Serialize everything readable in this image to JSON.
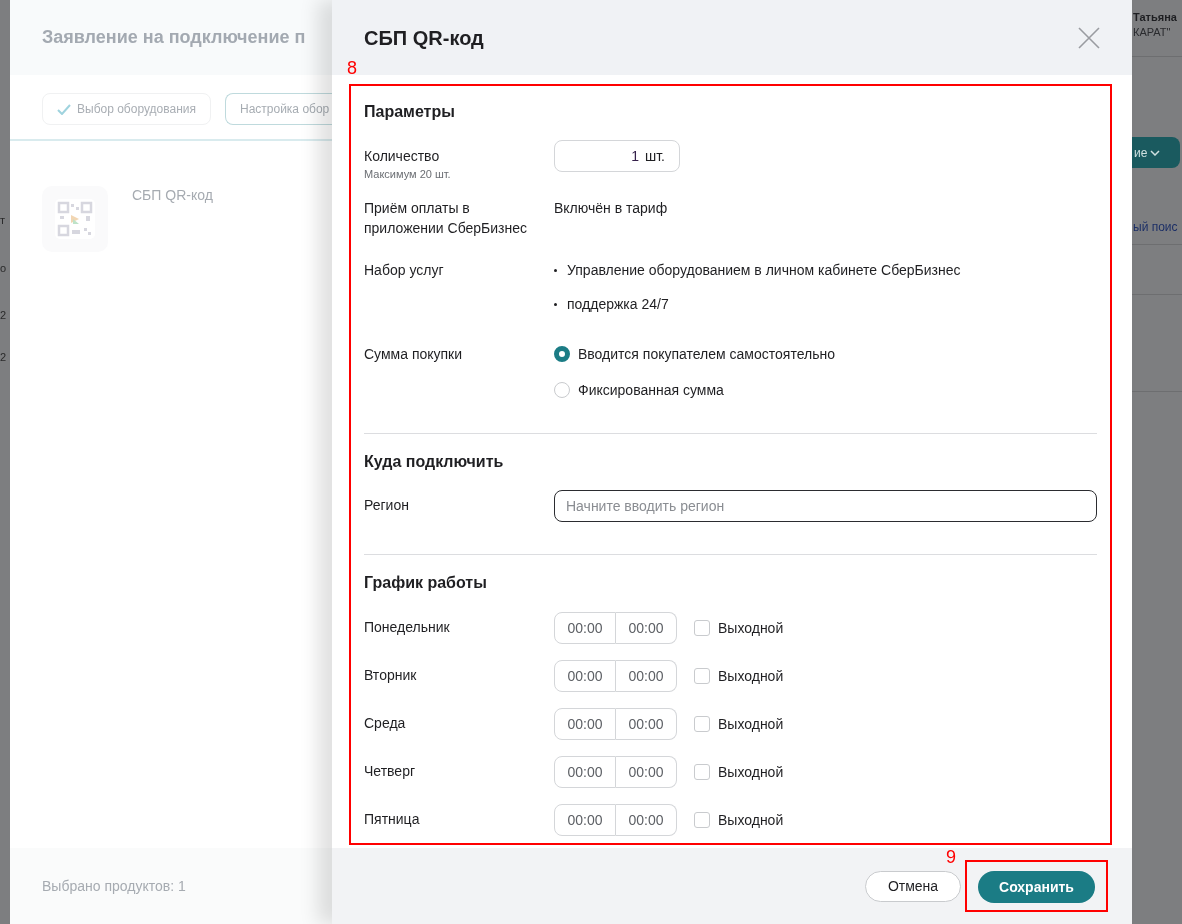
{
  "background_page": {
    "user_name": "Татьяна",
    "organization": "КАРАТ\"",
    "action_button": "ие",
    "search_link": "ый поис",
    "table_fragments": [
      "т",
      "о",
      "2",
      "2"
    ]
  },
  "drawer": {
    "title": "Заявление на подключение п",
    "steps": [
      {
        "label": "Выбор оборудования",
        "done": true
      },
      {
        "label": "Настройка обор",
        "done": false
      }
    ],
    "products": [
      {
        "name": "СБП QR-код"
      }
    ],
    "footer_text": "Выбрано продуктов: 1"
  },
  "dialog": {
    "title": "СБП QR-код",
    "body_annotation": "8",
    "sections": [
      {
        "title": "Параметры",
        "rows": [
          {
            "kind": "quantity",
            "label": "Количество",
            "hint": "Максимум 20 шт.",
            "value": "1",
            "unit": "шт."
          },
          {
            "kind": "text",
            "label": "Приём оплаты в приложении СберБизнес",
            "value": "Включён в тариф"
          },
          {
            "kind": "list",
            "label": "Набор услуг",
            "items": [
              "Управление оборудованием в личном кабинете СберБизнес",
              "поддержка 24/7"
            ]
          },
          {
            "kind": "radio",
            "label": "Сумма покупки",
            "options": [
              {
                "label": "Вводится покупателем самостоятельно",
                "selected": true
              },
              {
                "label": "Фиксированная сумма",
                "selected": false
              }
            ]
          }
        ]
      },
      {
        "title": "Куда подключить",
        "rows": [
          {
            "kind": "field",
            "label": "Регион",
            "placeholder": "Начните вводить регион"
          }
        ]
      },
      {
        "title": "График работы",
        "rows": [
          {
            "kind": "schedule",
            "label": "Понедельник",
            "from_placeholder": "00:00",
            "to_placeholder": "00:00",
            "day_off_label": "Выходной",
            "checked": false
          },
          {
            "kind": "schedule",
            "label": "Вторник",
            "from_placeholder": "00:00",
            "to_placeholder": "00:00",
            "day_off_label": "Выходной",
            "checked": false
          },
          {
            "kind": "schedule",
            "label": "Среда",
            "from_placeholder": "00:00",
            "to_placeholder": "00:00",
            "day_off_label": "Выходной",
            "checked": false
          },
          {
            "kind": "schedule",
            "label": "Четверг",
            "from_placeholder": "00:00",
            "to_placeholder": "00:00",
            "day_off_label": "Выходной",
            "checked": false
          },
          {
            "kind": "schedule",
            "label": "Пятница",
            "from_placeholder": "00:00",
            "to_placeholder": "00:00",
            "day_off_label": "Выходной",
            "checked": false
          }
        ]
      }
    ],
    "footer": {
      "cancel": "Отмена",
      "save": "Сохранить",
      "save_annotation": "9"
    }
  }
}
